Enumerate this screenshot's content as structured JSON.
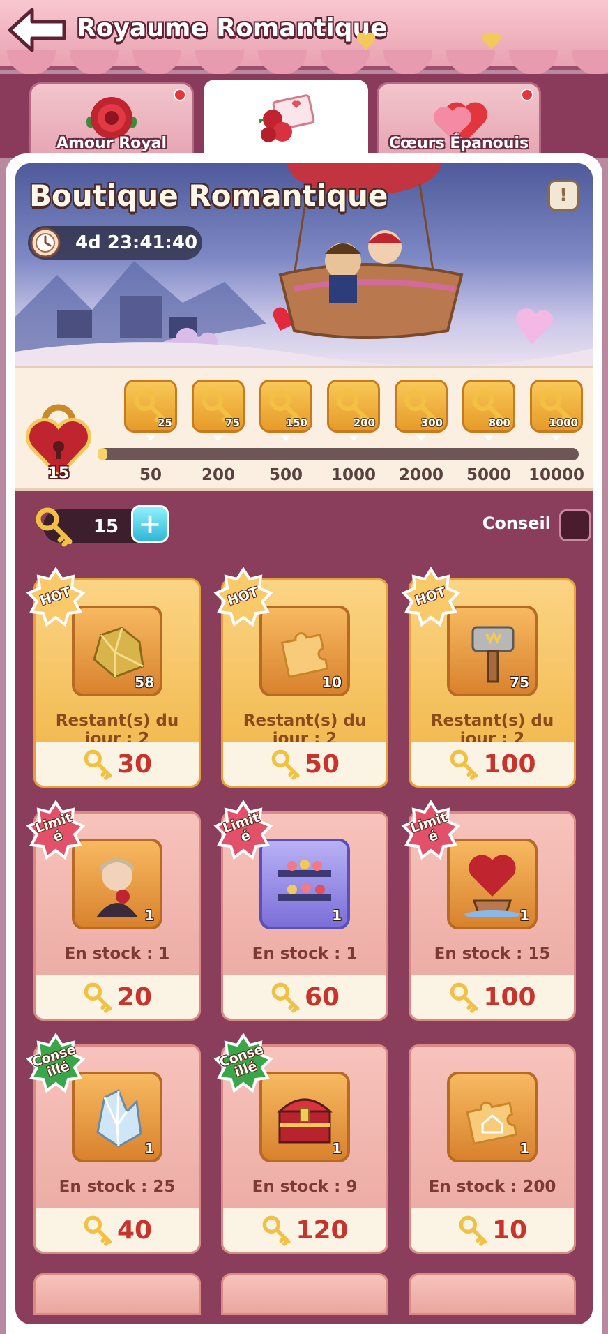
{
  "header": {
    "title": "Royaume Romantique",
    "back_icon": "back-arrow-icon"
  },
  "tabs": [
    {
      "label": "Amour Royal",
      "icon": "rose-icon",
      "active": false,
      "has_dot": true
    },
    {
      "label": "",
      "icon": "love-letter-icon",
      "active": true,
      "has_dot": false
    },
    {
      "label": "Cœurs Épanouis",
      "icon": "hearts-icon",
      "active": false,
      "has_dot": true
    }
  ],
  "banner": {
    "title": "Boutique Romantique",
    "timer": "4d 23:41:40",
    "info_icon": "!"
  },
  "progress": {
    "current": "15",
    "fill_fraction": 0.01,
    "milestones": [
      {
        "threshold": "50",
        "reward": "25"
      },
      {
        "threshold": "200",
        "reward": "75"
      },
      {
        "threshold": "500",
        "reward": "150"
      },
      {
        "threshold": "1000",
        "reward": "200"
      },
      {
        "threshold": "2000",
        "reward": "300"
      },
      {
        "threshold": "5000",
        "reward": "800"
      },
      {
        "threshold": "10000",
        "reward": "1000"
      }
    ]
  },
  "keybar": {
    "count": "15",
    "plus": "+",
    "advice_label": "Conseil"
  },
  "items": [
    {
      "badge": "HOT",
      "badge_type": "hot",
      "icon": "gold-ore-icon",
      "qty": "58",
      "stock": "Restant(s) du jour : 2",
      "price": "30"
    },
    {
      "badge": "HOT",
      "badge_type": "hot",
      "icon": "puzzle-piece-icon",
      "qty": "10",
      "stock": "Restant(s) du jour : 2",
      "price": "50"
    },
    {
      "badge": "HOT",
      "badge_type": "hot",
      "icon": "hammer-icon",
      "qty": "75",
      "stock": "Restant(s) du jour : 2",
      "price": "100"
    },
    {
      "badge": "Limit\né",
      "badge_type": "limited",
      "icon": "character-portrait-icon",
      "qty": "1",
      "stock": "En stock : 1",
      "price": "20"
    },
    {
      "badge": "Limit\né",
      "badge_type": "limited",
      "icon": "flower-shelf-icon",
      "qty": "1",
      "stock": "En stock : 1",
      "price": "60"
    },
    {
      "badge": "Limit\né",
      "badge_type": "limited",
      "icon": "heart-balloon-icon",
      "qty": "1",
      "stock": "En stock : 15",
      "price": "100"
    },
    {
      "badge": "Conse\nillé",
      "badge_type": "advised",
      "icon": "crystal-icon",
      "qty": "1",
      "stock": "En stock : 25",
      "price": "40"
    },
    {
      "badge": "Conse\nillé",
      "badge_type": "advised",
      "icon": "treasure-chest-icon",
      "qty": "1",
      "stock": "En stock : 9",
      "price": "120"
    },
    {
      "badge": "",
      "badge_type": "none",
      "icon": "house-puzzle-icon",
      "qty": "1",
      "stock": "En stock : 200",
      "price": "10"
    }
  ],
  "colors": {
    "accent": "#8b3e5c",
    "price": "#c8342b",
    "hot": "#f0b445",
    "limited": "#e2506a",
    "advised": "#3aa64a"
  }
}
